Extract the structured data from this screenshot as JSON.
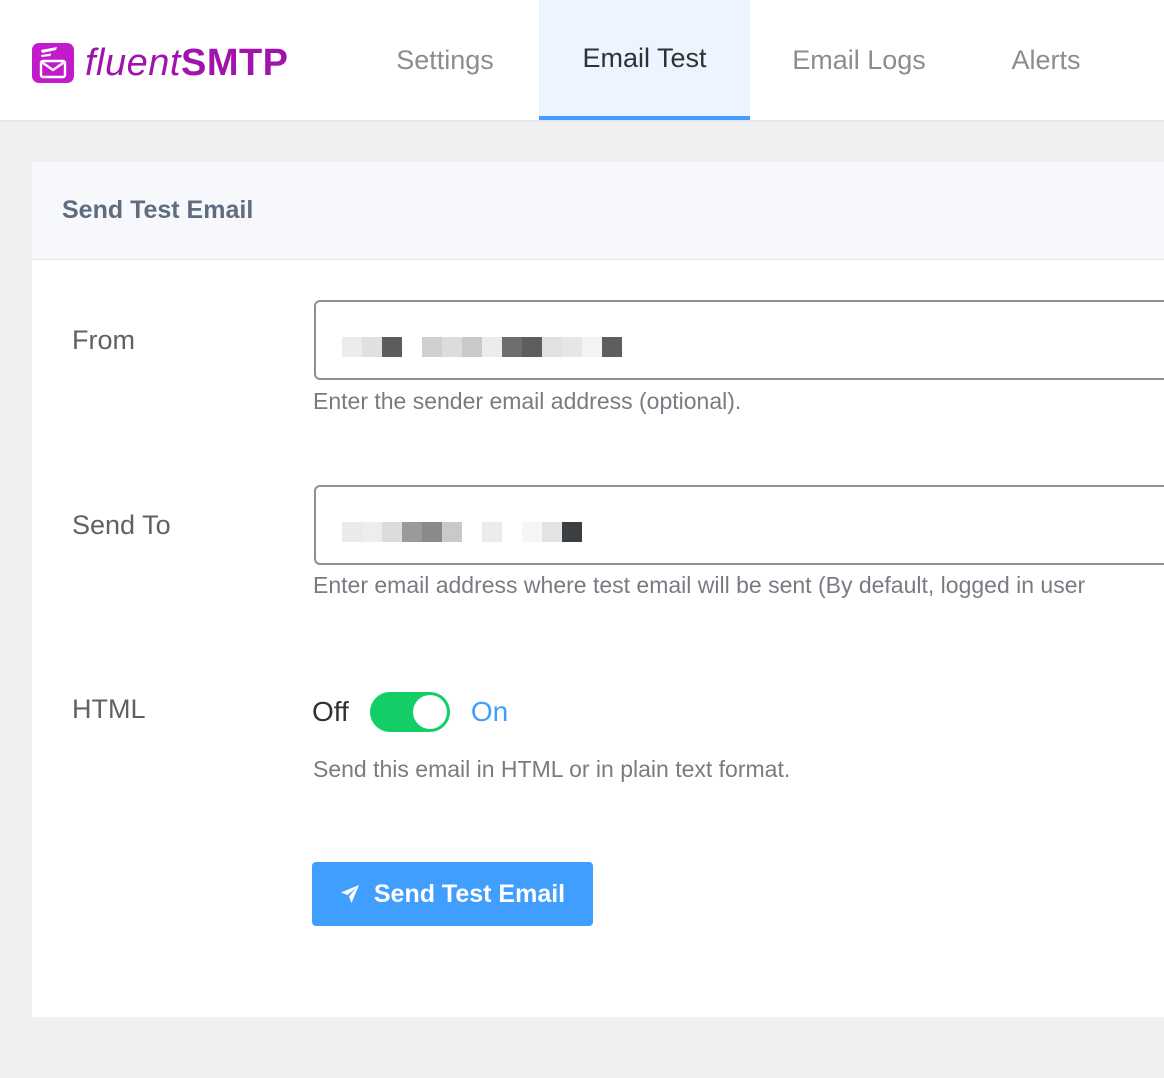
{
  "brand": {
    "word1": "fluent",
    "word2": "SMTP",
    "color": "#a114ac"
  },
  "tabs": [
    {
      "label": "Settings",
      "active": false
    },
    {
      "label": "Email Test",
      "active": true
    },
    {
      "label": "Email Logs",
      "active": false
    },
    {
      "label": "Alerts",
      "active": false
    }
  ],
  "card": {
    "title": "Send Test Email",
    "from": {
      "label": "From",
      "value_redacted": true,
      "help": "Enter the sender email address (optional)."
    },
    "send_to": {
      "label": "Send To",
      "value_redacted": true,
      "help": "Enter email address where test email will be sent (By default, logged in user"
    },
    "html": {
      "label": "HTML",
      "off_label": "Off",
      "on_label": "On",
      "enabled": true,
      "help": "Send this email in HTML or in plain text format."
    },
    "send_button": {
      "label": "Send Test Email",
      "icon": "paper-plane-icon"
    }
  },
  "colors": {
    "accent": "#409eff",
    "switch_on": "#13ce66",
    "active_tab_bg": "#ecf5ff"
  }
}
